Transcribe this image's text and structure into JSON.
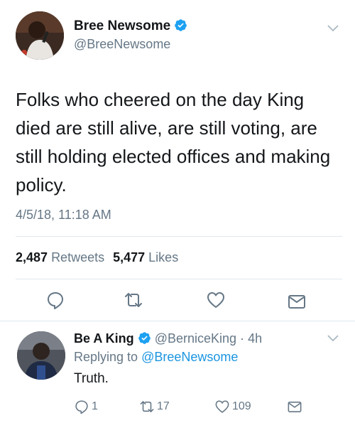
{
  "tweet": {
    "author_name": "Bree Newsome",
    "author_handle": "@BreeNewsome",
    "text": "Folks who cheered on the day King died are still alive, are still voting, are still holding elected offices and making policy.",
    "timestamp": "4/5/18, 11:18 AM",
    "retweets_count": "2,487",
    "retweets_label": "Retweets",
    "likes_count": "5,477",
    "likes_label": "Likes"
  },
  "reply": {
    "author_name": "Be A King",
    "author_handle": "@BerniceKing",
    "separator": "·",
    "age": "4h",
    "replying_prefix": "Replying to",
    "replying_to": "@BreeNewsome",
    "text": "Truth.",
    "reply_count": "1",
    "retweet_count": "17",
    "like_count": "109"
  },
  "colors": {
    "accent": "#1da1f2",
    "link": "#1b95e0",
    "muted_text": "#657786",
    "divider": "#e1e8ed"
  },
  "icons": [
    "verified-badge-icon",
    "chevron-down-icon",
    "reply-icon",
    "retweet-icon",
    "like-icon",
    "share-icon"
  ]
}
